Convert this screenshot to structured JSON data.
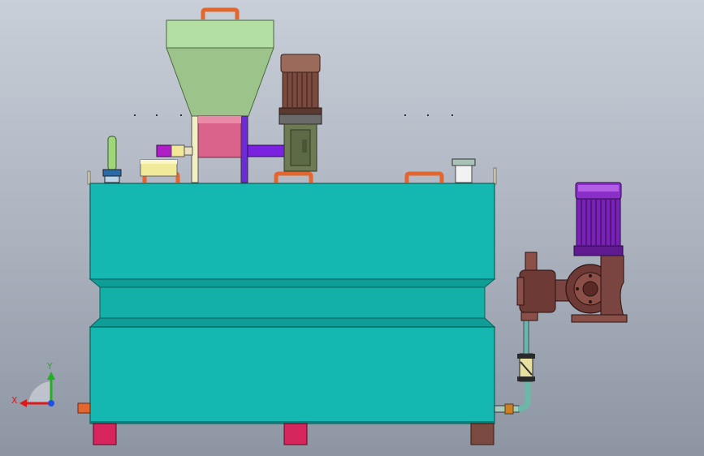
{
  "viewport": {
    "colors": {
      "background_top": "#c9cfd8",
      "background_bottom": "#8d95a3",
      "tank": "#14b8b0",
      "tank_edge": "#0a5f5a",
      "hopper": "#b4dfa2",
      "hopper_chute": "#d9638a",
      "auger_pipe": "#8a2be2",
      "motor_body": "#8a5a4a",
      "pump_motor": "#8b2fc9",
      "pump_body": "#6e3a36",
      "handle": "#e2662e",
      "foot": "#d6245c"
    }
  },
  "triad": {
    "x_label": "X",
    "y_label": "Y",
    "x_color": "#e01818",
    "y_color": "#22b022",
    "z_color": "#2050e0"
  }
}
